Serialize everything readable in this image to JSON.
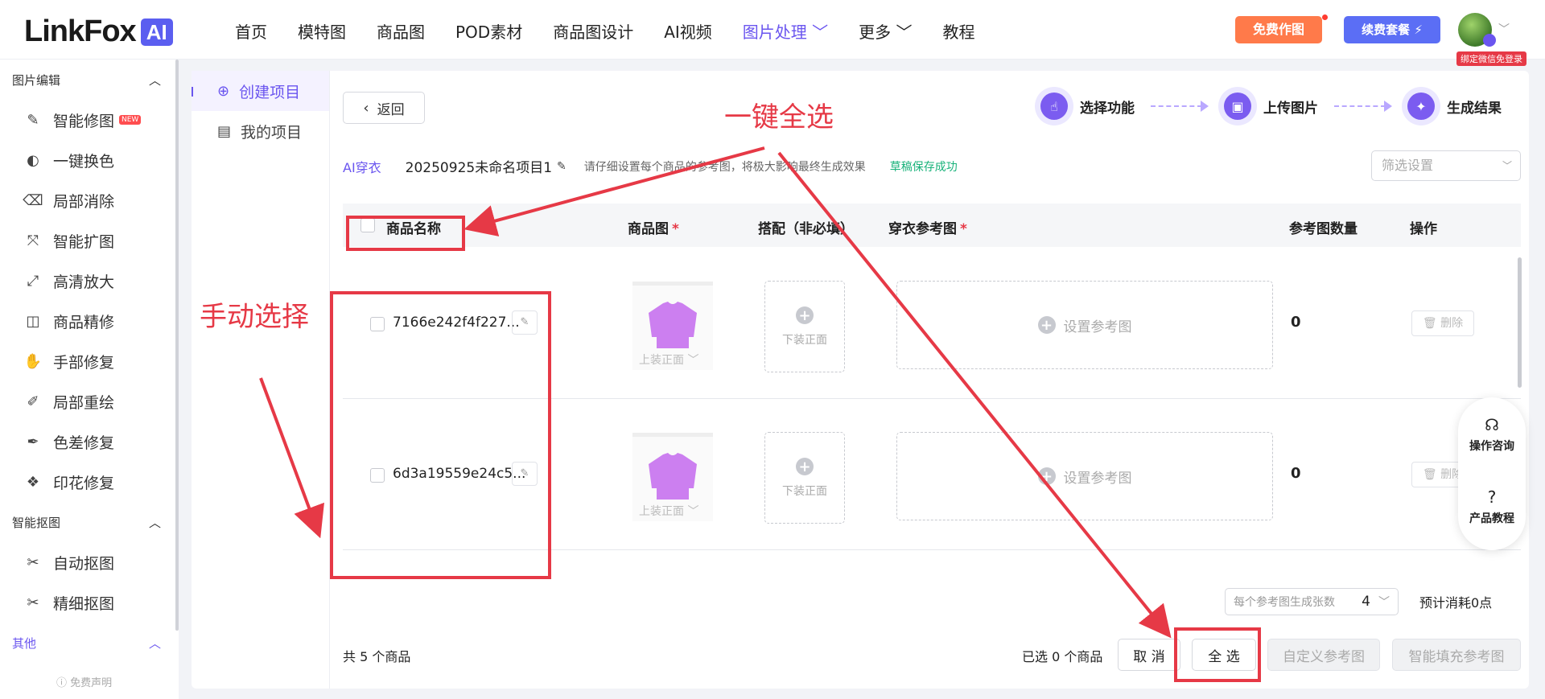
{
  "logo": {
    "text": "LinkFox",
    "badge": "AI"
  },
  "nav": {
    "items": [
      {
        "label": "首页"
      },
      {
        "label": "模特图"
      },
      {
        "label": "商品图"
      },
      {
        "label": "POD素材"
      },
      {
        "label": "商品图设计"
      },
      {
        "label": "AI视频"
      },
      {
        "label": "图片处理 ﹀"
      },
      {
        "label": "更多 ﹀"
      },
      {
        "label": "教程"
      }
    ],
    "active_index": 6,
    "free_label": "免费作图",
    "renew_label": "续费套餐 ⚡",
    "bind_label": "绑定微信免登录"
  },
  "sidebar": {
    "groups": [
      {
        "label": "图片编辑",
        "items": [
          "智能修图",
          "一键换色",
          "局部消除",
          "智能扩图",
          "高清放大",
          "商品精修",
          "手部修复",
          "局部重绘",
          "色差修复",
          "印花修复"
        ]
      },
      {
        "label": "智能抠图",
        "items": [
          "自动抠图",
          "精细抠图"
        ]
      },
      {
        "label": "其他",
        "items": []
      }
    ],
    "new_badge": "NEW",
    "disclaimer": "ⓘ 免费声明"
  },
  "subpanel": {
    "items": [
      "创建项目",
      "我的项目"
    ]
  },
  "main": {
    "back_label": "返回",
    "steps": [
      "选择功能",
      "上传图片",
      "生成结果"
    ],
    "info": {
      "tag": "AI穿衣",
      "project": "20250925未命名项目1",
      "tip": "请仔细设置每个商品的参考图，将极大影响最终生成效果",
      "saved": "草稿保存成功"
    },
    "filter_placeholder": "筛选设置",
    "columns": [
      "商品名称",
      "商品图",
      "搭配（非必填）",
      "穿衣参考图",
      "参考图数量",
      "操作"
    ],
    "rows": [
      {
        "name": "7166e242f4f227...",
        "thumb_label": "上装正面 ﹀",
        "match_label": "下装正面",
        "ref_label": "设置参考图",
        "count": "0",
        "delete_label": "删除"
      },
      {
        "name": "6d3a19559e24c5...",
        "thumb_label": "上装正面 ﹀",
        "match_label": "下装正面",
        "ref_label": "设置参考图",
        "count": "0",
        "delete_label": "删除"
      }
    ],
    "gen_per_ref_label": "每个参考图生成张数",
    "gen_per_ref_value": "4",
    "estimate": "预计消耗0点",
    "total": "共 5 个商品",
    "selected": "已选 0 个商品",
    "cancel_label": "取 消",
    "select_all_label": "全 选",
    "custom_ref_label": "自定义参考图",
    "smart_fill_label": "智能填充参考图"
  },
  "float_panel": {
    "consult": "操作咨询",
    "tutorial": "产品教程"
  },
  "annotations": {
    "select_all": "一键全选",
    "manual": "手动选择"
  },
  "colors": {
    "accent": "#6a55ef",
    "annotation": "#e63946",
    "free_btn": "#ff7a4a",
    "renew_btn": "#5b6ef5",
    "saved_text": "#18b27a",
    "shirt": "#cc7ff0"
  }
}
